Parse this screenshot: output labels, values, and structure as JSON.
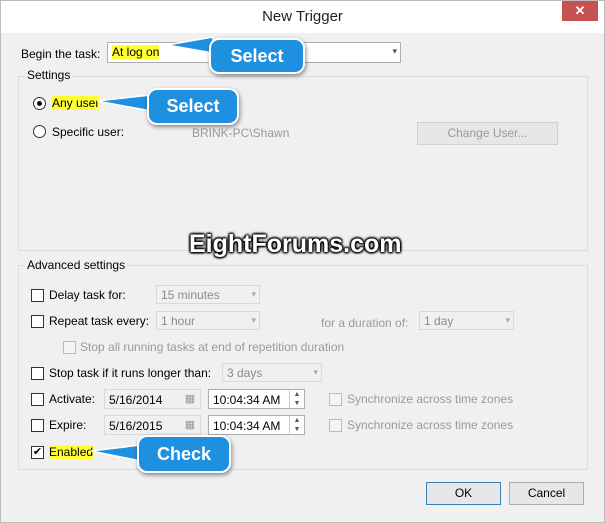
{
  "window": {
    "title": "New Trigger",
    "close_glyph": "✕"
  },
  "begin_task": {
    "label": "Begin the task:",
    "value": "At log on"
  },
  "settings": {
    "group_label": "Settings",
    "any_user_label": "Any user",
    "any_user_selected": true,
    "specific_user_label": "Specific user:",
    "specific_user_selected": false,
    "user_value": "BRINK-PC\\Shawn",
    "change_user_label": "Change User..."
  },
  "watermark": "EightForums.com",
  "advanced": {
    "group_label": "Advanced settings",
    "delay": {
      "label": "Delay task for:",
      "checked": false,
      "value": "15 minutes"
    },
    "repeat": {
      "label": "Repeat task every:",
      "checked": false,
      "value": "1 hour",
      "duration_label": "for a duration of:",
      "duration_value": "1 day"
    },
    "stop_running": {
      "label": "Stop all running tasks at end of repetition duration",
      "checked": false
    },
    "stop_if_longer": {
      "label": "Stop task if it runs longer than:",
      "checked": false,
      "value": "3 days"
    },
    "activate": {
      "label": "Activate:",
      "checked": false,
      "date": "5/16/2014",
      "time": "10:04:34 AM",
      "sync_label": "Synchronize across time zones"
    },
    "expire": {
      "label": "Expire:",
      "checked": false,
      "date": "5/16/2015",
      "time": "10:04:34 AM",
      "sync_label": "Synchronize across time zones"
    },
    "enabled": {
      "label": "Enabled",
      "checked": true,
      "check_glyph": "✔"
    }
  },
  "buttons": {
    "ok": "OK",
    "cancel": "Cancel"
  },
  "callouts": {
    "select_1": "Select",
    "select_2": "Select",
    "check": "Check"
  },
  "colors": {
    "callout": "#1f90e0",
    "highlight": "#ffff33",
    "close": "#c75050"
  },
  "icons": {
    "dropdown": "▾",
    "calendar": "▦",
    "spin_up": "▲",
    "spin_down": "▼"
  }
}
